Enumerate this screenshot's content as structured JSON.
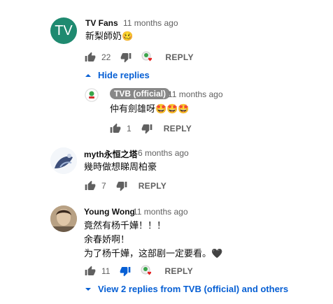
{
  "comments": [
    {
      "author": "TV Fans",
      "avatar_text": "TV",
      "time": "11 months ago",
      "text": [
        "新梨師奶🥴"
      ],
      "likes": "22",
      "reply_label": "REPLY",
      "hide_replies_label": "Hide replies",
      "reply": {
        "author": "TVB (official)",
        "time": "11 months ago",
        "text": "仲有劍雄呀🤩🤩🤩",
        "likes": "1",
        "reply_label": "REPLY"
      }
    },
    {
      "author": "myth永恒之塔",
      "time": "6 months ago",
      "text": [
        "幾時做想睇周柏豪"
      ],
      "likes": "7",
      "reply_label": "REPLY"
    },
    {
      "author": "Young Wong",
      "time": "11 months ago",
      "text": [
        "竟然有杨千嬅！！！",
        "余春娇啊！",
        "为了杨千嬅，这部剧一定要看。🖤"
      ],
      "likes": "11",
      "reply_label": "REPLY",
      "view_replies_label": "View 2 replies from TVB (official) and others"
    }
  ],
  "colors": {
    "accent": "#065fd4",
    "badge": "#888888",
    "tv_avatar": "#1f8a70"
  }
}
